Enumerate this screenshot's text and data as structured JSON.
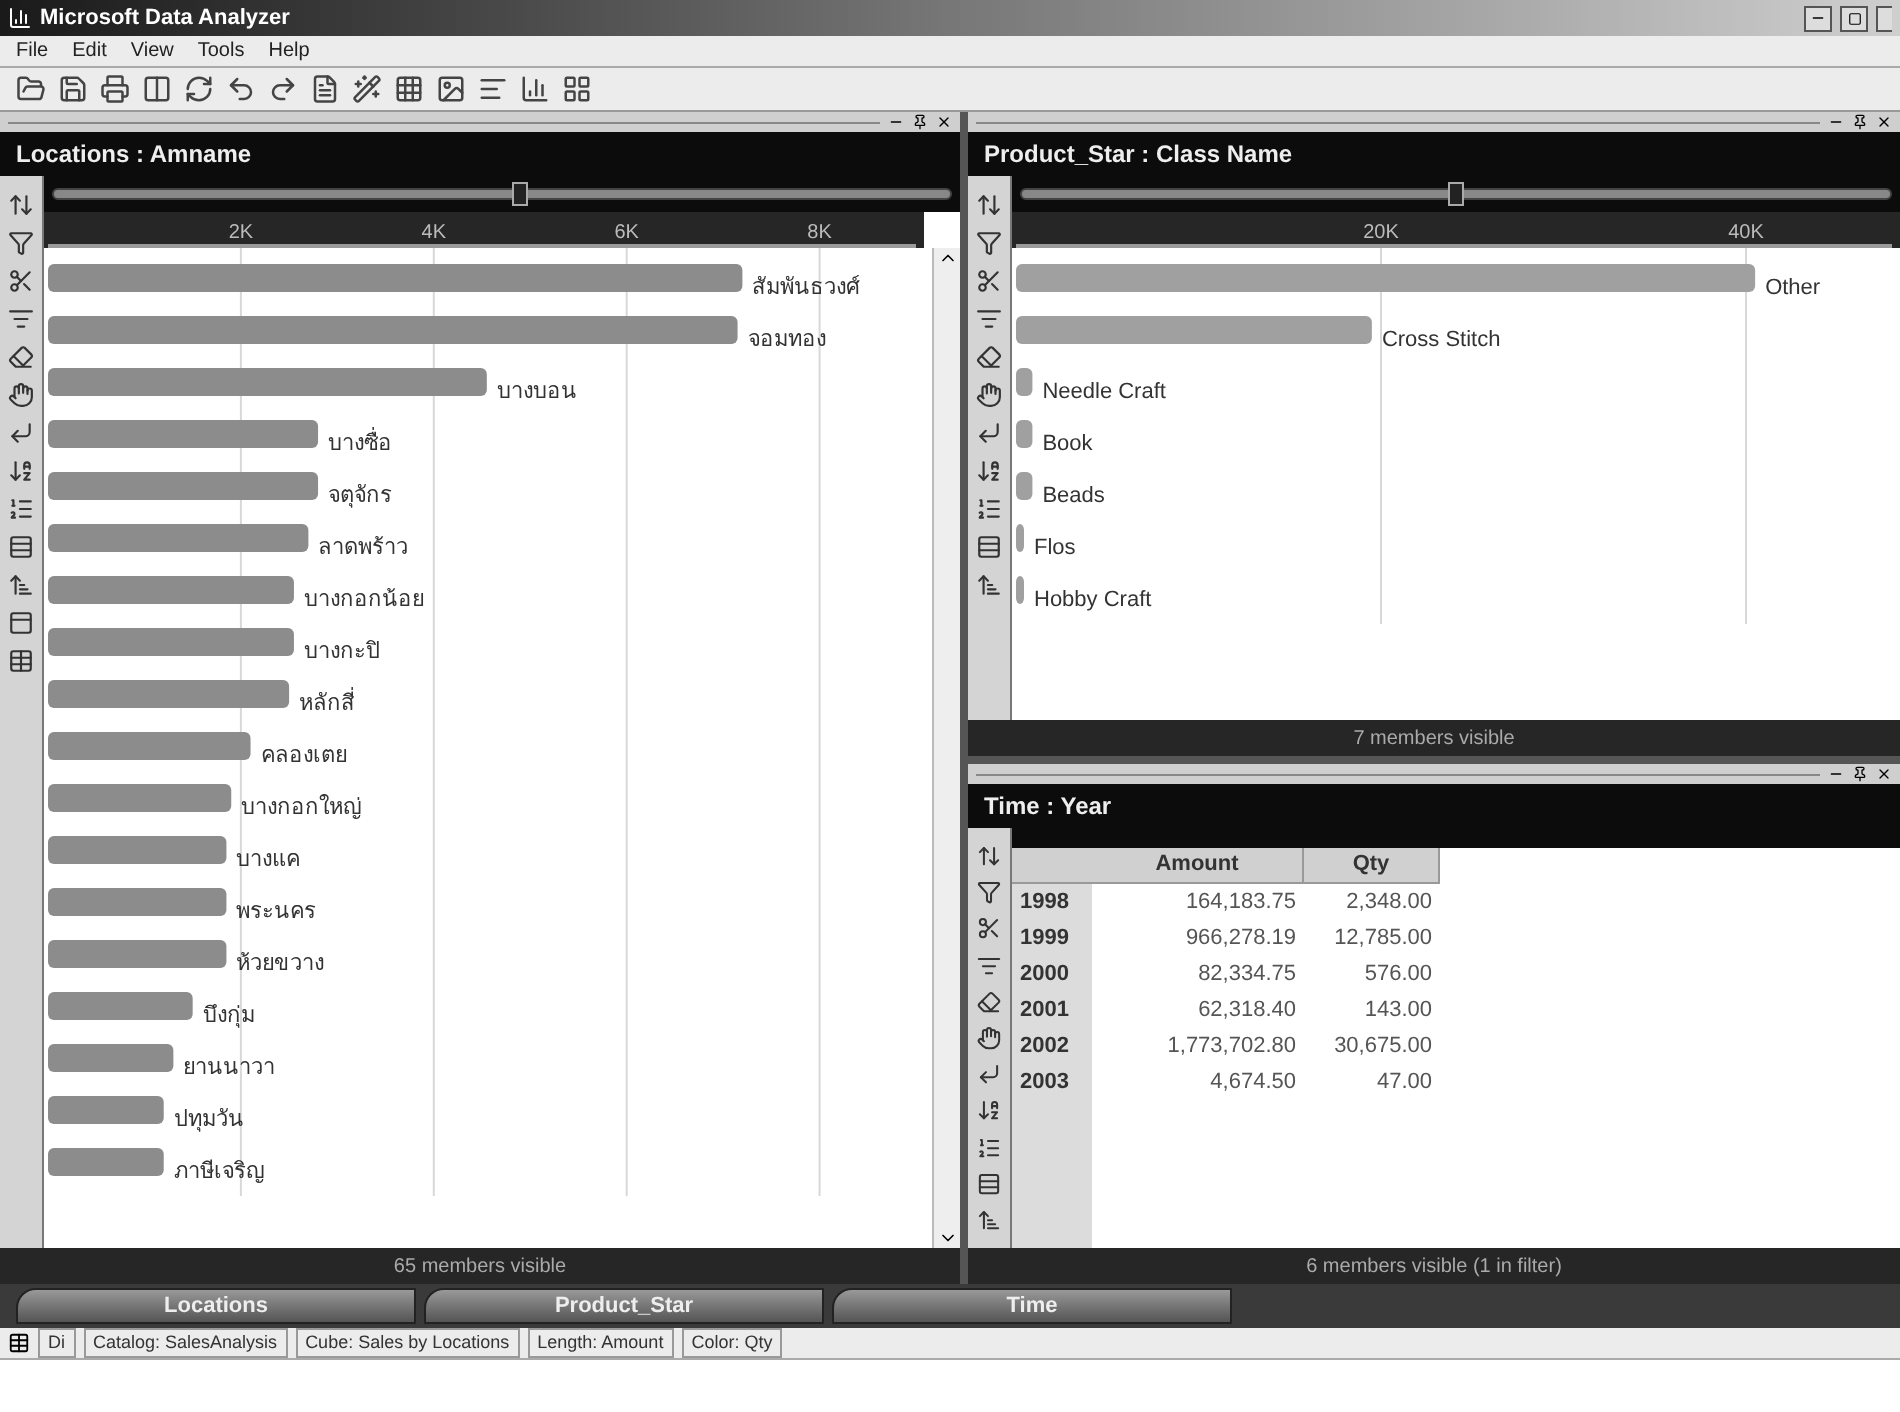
{
  "window": {
    "title": "Microsoft Data Analyzer"
  },
  "menu": [
    "File",
    "Edit",
    "View",
    "Tools",
    "Help"
  ],
  "panes": [
    {
      "kind": "chart",
      "title": "Locations : Amname",
      "slider": {
        "level": 0.52
      },
      "footer": "65 members visible",
      "chart_data": {
        "type": "bar",
        "orientation": "horizontal",
        "categories": [
          "สัมพันธวงศ์",
          "จอมทอง",
          "บางบอน",
          "บางซื่อ",
          "จตุจักร",
          "ลาดพร้าว",
          "บางกอกน้อย",
          "บางกะปิ",
          "หลักสี่",
          "คลองเตย",
          "บางกอกใหญ่",
          "บางแค",
          "พระนคร",
          "ห้วยขวาง",
          "บึงกุ่ม",
          "ยานนาวา",
          "ปทุมวัน",
          "ภาษีเจริญ"
        ],
        "series": [
          {
            "color": "#8c8c8c",
            "values": [
              7.2,
              7.15,
              4.55,
              2.8,
              2.8,
              2.7,
              2.55,
              2.55,
              2.5,
              2.1,
              1.9,
              1.85,
              1.85,
              1.85,
              1.5,
              1.3,
              1.2,
              1.2
            ]
          }
        ],
        "grid": true,
        "xlim": [
          0,
          9
        ],
        "xticks": [
          {
            "value": 2,
            "label": "2K"
          },
          {
            "value": 4,
            "label": "4K"
          },
          {
            "value": 6,
            "label": "6K"
          },
          {
            "value": 8,
            "label": "8K"
          }
        ]
      }
    },
    {
      "kind": "chart",
      "title": "Product_Star : Class Name",
      "slider": {
        "level": 0.5
      },
      "footer": "7 members visible",
      "chart_data": {
        "type": "bar",
        "orientation": "horizontal",
        "categories": [
          "Other",
          "Cross Stitch",
          "Needle Craft",
          "Book",
          "Beads",
          "Flos",
          "Hobby Craft"
        ],
        "series": [
          {
            "color": "#a0a0a0",
            "values": [
              40.5,
              19.5,
              0.9,
              0.9,
              0.9,
              0.3,
              0.3
            ]
          }
        ],
        "grid": true,
        "xlim": [
          0,
          48
        ],
        "xticks": [
          {
            "value": 20,
            "label": "20K"
          },
          {
            "value": 40,
            "label": "40K"
          }
        ]
      }
    },
    {
      "kind": "table",
      "title": "Time : Year",
      "footer": "6 members visible (1 in filter)",
      "table": {
        "columns": [
          "Amount",
          "Qty"
        ],
        "rows": [
          {
            "year": "1998",
            "cells": [
              "164,183.75",
              "2,348.00"
            ]
          },
          {
            "year": "1999",
            "cells": [
              "966,278.19",
              "12,785.00"
            ]
          },
          {
            "year": "2000",
            "cells": [
              "82,334.75",
              "576.00"
            ]
          },
          {
            "year": "2001",
            "cells": [
              "62,318.40",
              "143.00"
            ]
          },
          {
            "year": "2002",
            "cells": [
              "1,773,702.80",
              "30,675.00"
            ]
          },
          {
            "year": "2003",
            "cells": [
              "4,674.50",
              "47.00"
            ]
          }
        ]
      }
    }
  ],
  "dimension_tabs": [
    "Locations",
    "Product_Star",
    "Time"
  ],
  "status_bar": [
    "Di",
    "Catalog: SalesAnalysis",
    "Cube: Sales by Locations",
    "Length: Amount",
    "Color: Qty"
  ]
}
